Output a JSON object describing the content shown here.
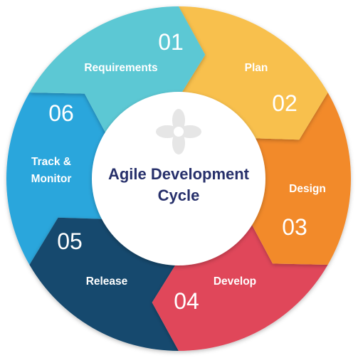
{
  "center": {
    "title_line1": "Agile Development",
    "title_line2": "Cycle",
    "color": "#27306b"
  },
  "stages": [
    {
      "number": "01",
      "label_lines": [
        "Requirements"
      ],
      "color": "#5cc8d4"
    },
    {
      "number": "02",
      "label_lines": [
        "Plan"
      ],
      "color": "#f8c04e"
    },
    {
      "number": "03",
      "label_lines": [
        "Design"
      ],
      "color": "#f28a2c"
    },
    {
      "number": "04",
      "label_lines": [
        "Develop"
      ],
      "color": "#e0475a"
    },
    {
      "number": "05",
      "label_lines": [
        "Release"
      ],
      "color": "#16496e"
    },
    {
      "number": "06",
      "label_lines": [
        "Track &",
        "Monitor"
      ],
      "color": "#2aa6dc"
    }
  ],
  "icons": {
    "center": "flower-logo-icon"
  }
}
